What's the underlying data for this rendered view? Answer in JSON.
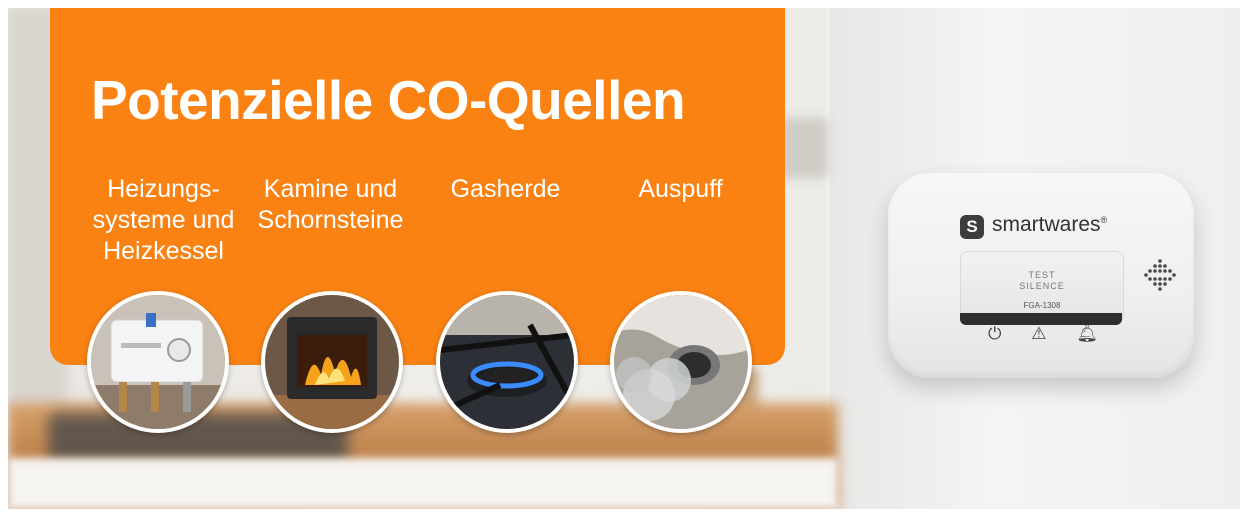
{
  "title": "Potenzielle CO-Quellen",
  "sources": [
    {
      "label_lines": [
        "Heizungs-",
        "systeme und",
        "Heizkessel"
      ],
      "image": "boiler-photo"
    },
    {
      "label_lines": [
        "Kamine und",
        "Schornsteine"
      ],
      "image": "fireplace-photo"
    },
    {
      "label_lines": [
        "Gasherde"
      ],
      "image": "gas-stove-photo"
    },
    {
      "label_lines": [
        "Auspuff"
      ],
      "image": "exhaust-photo"
    }
  ],
  "detector": {
    "logo_letter": "S",
    "brand": "smartwares",
    "brand_mark": "®",
    "button_line1": "TEST",
    "button_line2": "SILENCE",
    "model": "FGA-1308",
    "indicators": [
      "power-icon",
      "warning-icon",
      "bell-icon"
    ]
  },
  "colors": {
    "accent": "#f98213",
    "text": "#ffffff"
  }
}
